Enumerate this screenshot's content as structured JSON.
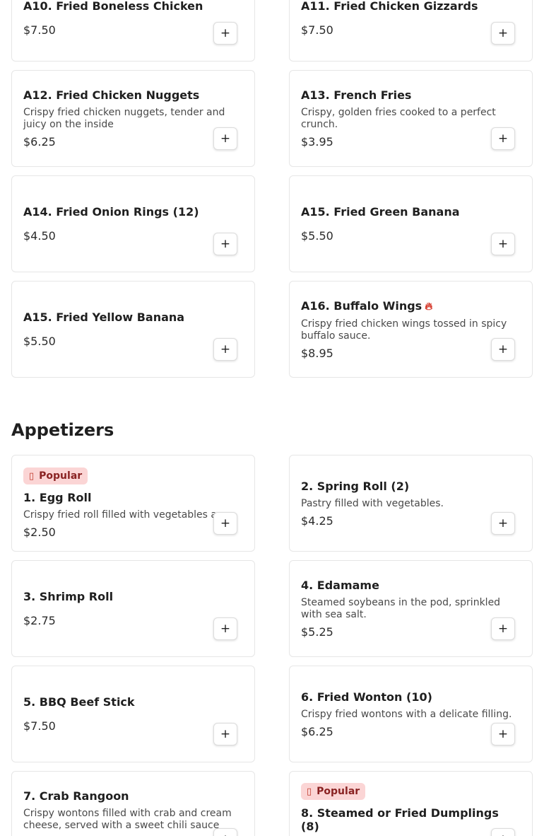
{
  "fried_items": [
    {
      "name": "A10. Fried Boneless Chicken",
      "price": "$7.50"
    },
    {
      "name": "A11. Fried Chicken Gizzards",
      "price": "$7.50"
    },
    {
      "name": "A12. Fried Chicken Nuggets",
      "description": "Crispy fried chicken nuggets, tender and juicy on the inside",
      "price": "$6.25"
    },
    {
      "name": "A13. French Fries",
      "description": "Crispy, golden fries cooked to a perfect crunch.",
      "price": "$3.95"
    },
    {
      "name": "A14. Fried Onion Rings (12)",
      "price": "$4.50"
    },
    {
      "name": "A15. Fried Green Banana",
      "price": "$5.50"
    },
    {
      "name": "A15. Fried Yellow Banana",
      "price": "$5.50"
    },
    {
      "name": "A16. Buffalo Wings",
      "description": "Crispy fried chicken wings tossed in spicy buffalo sauce.",
      "price": "$8.95",
      "spicy_icon": "flame-icon"
    }
  ],
  "appetizers": {
    "heading": "Appetizers",
    "items": [
      {
        "badge": "Popular",
        "name": "1. Egg Roll",
        "description": "Crispy fried roll filled with vegetables a...",
        "price": "$2.50"
      },
      {
        "name": "2. Spring Roll (2)",
        "description": "Pastry filled with vegetables.",
        "price": "$4.25"
      },
      {
        "name": "3. Shrimp Roll",
        "price": "$2.75"
      },
      {
        "name": "4. Edamame",
        "description": "Steamed soybeans in the pod, sprinkled with sea salt.",
        "price": "$5.25"
      },
      {
        "name": "5. BBQ Beef Stick",
        "price": "$7.50"
      },
      {
        "name": "6. Fried Wonton (10)",
        "description": "Crispy fried wontons with a delicate filling.",
        "price": "$6.25"
      },
      {
        "name": "7. Crab Rangoon",
        "description": "Crispy wontons filled with crab and cream cheese, served with a sweet chili sauce",
        "price": ""
      },
      {
        "badge": "Popular",
        "name": "8. Steamed or Fried Dumplings (8)",
        "price": ""
      }
    ]
  },
  "add_button_label": "+",
  "icons": {
    "add": "plus-icon",
    "popular": "fire-icon",
    "spicy": "flame-icon"
  },
  "colors": {
    "badge_bg": "#fbd5d5",
    "badge_text": "#8a2222",
    "spicy": "#d63a2c",
    "border": "#e6e6e6"
  }
}
